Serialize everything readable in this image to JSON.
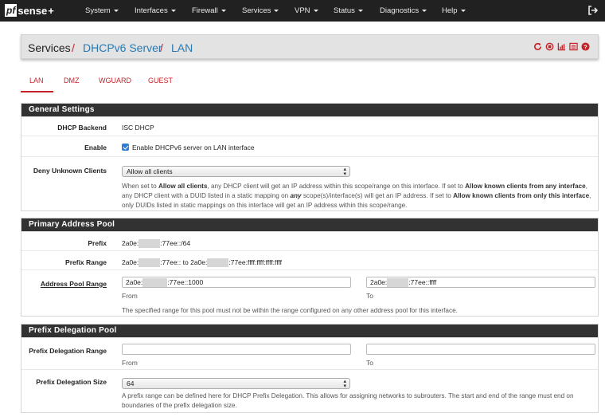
{
  "navbar": {
    "logo_box": "pf",
    "logo_rest": "sense",
    "logo_plus": "+",
    "items": [
      {
        "label": "System"
      },
      {
        "label": "Interfaces"
      },
      {
        "label": "Firewall"
      },
      {
        "label": "Services"
      },
      {
        "label": "VPN"
      },
      {
        "label": "Status"
      },
      {
        "label": "Diagnostics"
      },
      {
        "label": "Help"
      }
    ]
  },
  "breadcrumb": {
    "part1": "Services",
    "sep": "/",
    "part2": "DHCPv6 Server",
    "part3": "LAN"
  },
  "tabs": [
    {
      "label": "LAN",
      "active": true
    },
    {
      "label": "DMZ"
    },
    {
      "label": "WGUARD"
    },
    {
      "label": "GUEST"
    }
  ],
  "general": {
    "title": "General Settings",
    "backend_label": "DHCP Backend",
    "backend_value": "ISC DHCP",
    "enable_label": "Enable",
    "enable_text": "Enable DHCPv6 server on LAN interface",
    "enable_checked": true,
    "deny_label": "Deny Unknown Clients",
    "deny_value": "Allow all clients",
    "help": {
      "t1": "When set to ",
      "b1": "Allow all clients",
      "t2": ", any DHCP client will get an IP address within this scope/range on this interface. If set to ",
      "b2": "Allow known clients from any interface",
      "t3": ", any DHCP client with a DUID listed in a static mapping on ",
      "b3": "any",
      "t4": " scope(s)/interface(s) will get an IP address. If set to ",
      "b4": "Allow known clients from only this interface",
      "t5": ", only DUIDs listed in static mappings on this interface will get an IP address within this scope/range."
    }
  },
  "pool": {
    "title": "Primary Address Pool",
    "prefix_label": "Prefix",
    "prefix_a": "2a0e:",
    "prefix_b": ":77ee::/64",
    "range_label": "Prefix Range",
    "range_a": "2a0e:",
    "range_b": ":77ee:: to 2a0e:",
    "range_c": ":77ee:ffff:ffff:ffff:ffff",
    "addr_label": "Address Pool Range",
    "from_a": "2a0e:",
    "from_b": ":77ee::1000",
    "to_a": "2a0e:",
    "to_b": ":77ee::ffff",
    "from_label": "From",
    "to_label": "To",
    "help": "The specified range for this pool must not be within the range configured on any other address pool for this interface."
  },
  "pd": {
    "title": "Prefix Delegation Pool",
    "range_label": "Prefix Delegation Range",
    "from_value": "",
    "to_value": "",
    "from_label": "From",
    "to_label": "To",
    "size_label": "Prefix Delegation Size",
    "size_value": "64",
    "help": "A prefix range can be defined here for DHCP Prefix Delegation. This allows for assigning networks to subrouters. The start and end of the range must end on boundaries of the prefix delegation size."
  }
}
